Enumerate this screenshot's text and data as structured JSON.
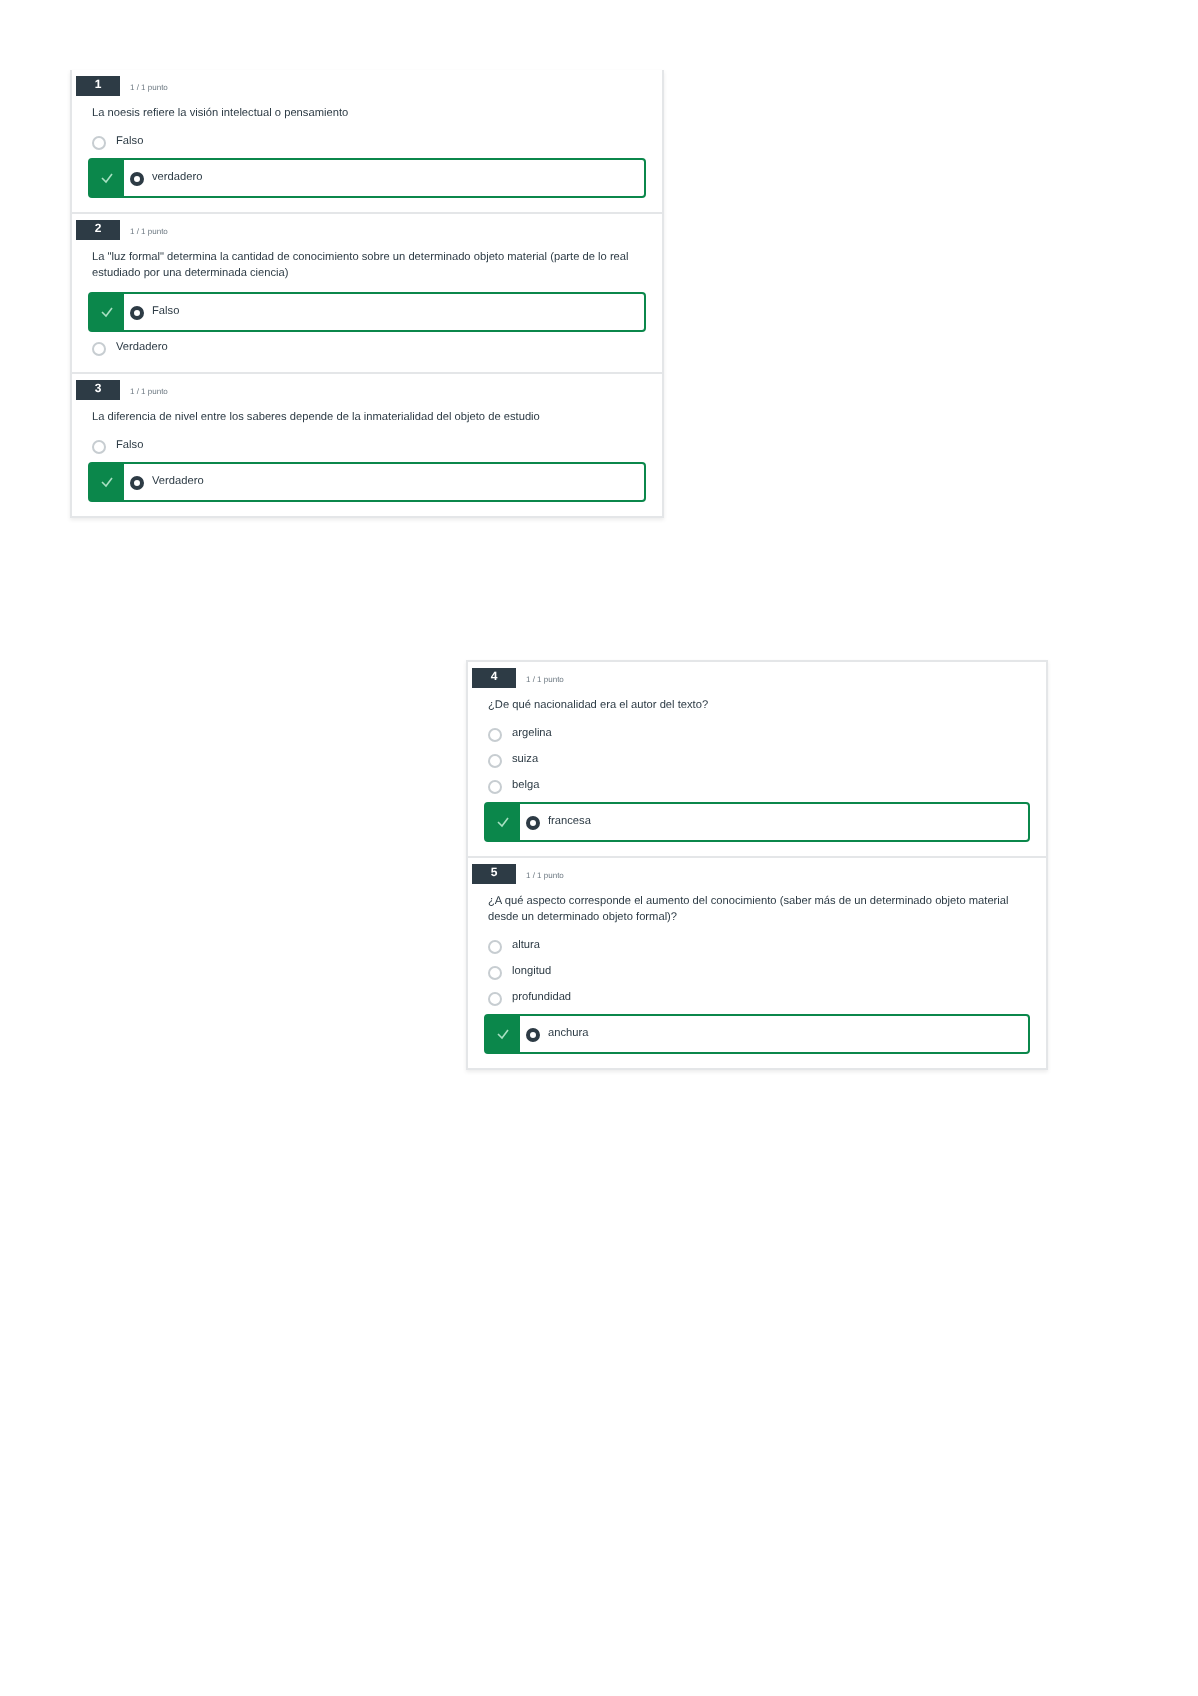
{
  "panels": [
    {
      "questions": [
        {
          "number": "1",
          "score": "1 / 1 punto",
          "text": "La noesis refiere la visión intelectual o pensamiento",
          "options": [
            {
              "label": "Falso",
              "selected": false
            },
            {
              "label": "verdadero",
              "selected": true
            }
          ]
        },
        {
          "number": "2",
          "score": "1 / 1 punto",
          "text": "La \"luz formal\" determina la cantidad de conocimiento sobre un determinado objeto material (parte de lo real estudiado por una determinada ciencia)",
          "options": [
            {
              "label": "Falso",
              "selected": true
            },
            {
              "label": "Verdadero",
              "selected": false
            }
          ]
        },
        {
          "number": "3",
          "score": "1 / 1 punto",
          "text": "La diferencia de nivel entre los saberes depende de la inmaterialidad del objeto de estudio",
          "options": [
            {
              "label": "Falso",
              "selected": false
            },
            {
              "label": "Verdadero",
              "selected": true
            }
          ]
        }
      ]
    },
    {
      "questions": [
        {
          "number": "4",
          "score": "1 / 1 punto",
          "text": "¿De qué nacionalidad era el autor del texto?",
          "options": [
            {
              "label": "argelina",
              "selected": false
            },
            {
              "label": "suiza",
              "selected": false
            },
            {
              "label": "belga",
              "selected": false
            },
            {
              "label": "francesa",
              "selected": true
            }
          ]
        },
        {
          "number": "5",
          "score": "1 / 1 punto",
          "text": "¿A qué aspecto corresponde el aumento del conocimiento (saber más de un determinado objeto material desde un determinado objeto formal)?",
          "options": [
            {
              "label": "altura",
              "selected": false
            },
            {
              "label": "longitud",
              "selected": false
            },
            {
              "label": "profundidad",
              "selected": false
            },
            {
              "label": "anchura",
              "selected": true
            }
          ]
        }
      ]
    }
  ]
}
